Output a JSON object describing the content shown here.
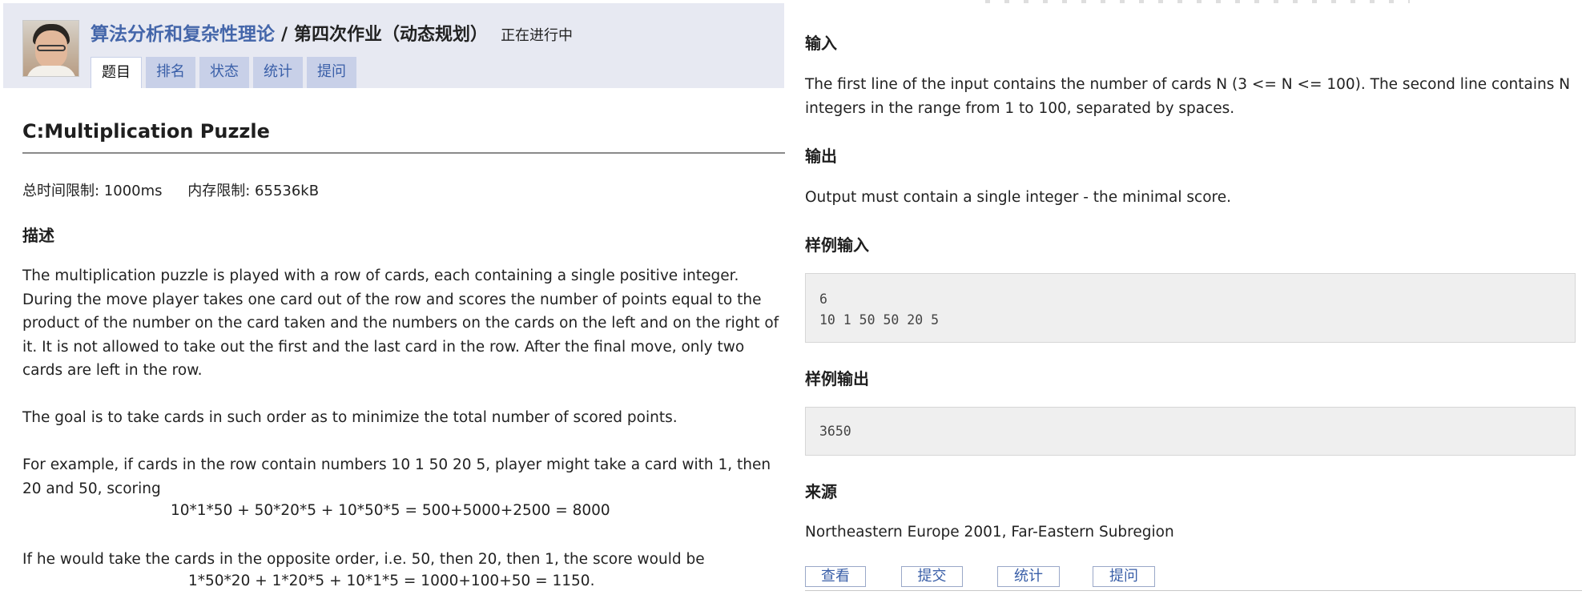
{
  "header": {
    "course_link": "算法分析和复杂性理论",
    "separator": "/",
    "assignment_title": "第四次作业（动态规划）",
    "status": "正在进行中",
    "tabs": [
      {
        "label": "题目",
        "active": true
      },
      {
        "label": "排名",
        "active": false
      },
      {
        "label": "状态",
        "active": false
      },
      {
        "label": "统计",
        "active": false
      },
      {
        "label": "提问",
        "active": false
      }
    ]
  },
  "problem": {
    "title": "C:Multiplication Puzzle",
    "time_limit": "总时间限制: 1000ms",
    "memory_limit": "内存限制: 65536kB",
    "description_heading": "描述",
    "description": [
      "The multiplication puzzle is played with a row of cards, each containing a single positive integer. During the move player takes one card out of the row and scores the number of points equal to the product of the number on the card taken and the numbers on the cards on the left and on the right of it. It is not allowed to take out the first and the last card in the row. After the final move, only two cards are left in the row.",
      "The goal is to take cards in such order as to minimize the total number of scored points.",
      "For example, if cards in the row contain numbers 10 1 50 20 5, player might take a card with 1, then 20 and 50, scoring",
      "If he would take the cards in the opposite order, i.e. 50, then 20, then 1, the score would be"
    ],
    "formula_1": "10*1*50 + 50*20*5 + 10*50*5 = 500+5000+2500 = 8000",
    "formula_2": "1*50*20 + 1*20*5 + 10*1*5 = 1000+100+50 = 1150.",
    "input_heading": "输入",
    "input_text": "The first line of the input contains the number of cards N (3 <= N <= 100). The second line contains N integers in the range from 1 to 100, separated by spaces.",
    "output_heading": "输出",
    "output_text": "Output must contain a single integer - the minimal score.",
    "sample_input_heading": "样例输入",
    "sample_input_lines": [
      "6",
      "10 1 50 50 20 5"
    ],
    "sample_output_heading": "样例输出",
    "sample_output": "3650",
    "source_heading": "来源",
    "source_text": "Northeastern Europe 2001, Far-Eastern Subregion"
  },
  "actions": {
    "view": "查看",
    "submit": "提交",
    "stats": "统计",
    "ask": "提问"
  },
  "colors": {
    "header_band": "#e7e9f2",
    "link_blue": "#4466aa",
    "tab_bg": "#c8d0e8",
    "sample_bg": "#efefef"
  }
}
